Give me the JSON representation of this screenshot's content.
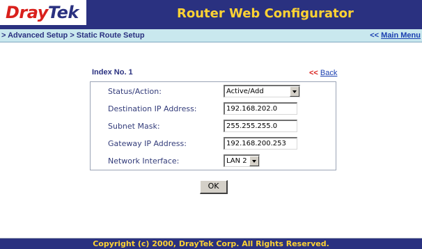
{
  "header": {
    "logo_part1": "Dray",
    "logo_part2": "Tek",
    "app_title": "Router Web Configurator"
  },
  "nav": {
    "breadcrumb": "> Advanced Setup > Static Route Setup",
    "main_menu_arrows": "<<",
    "main_menu_label": "Main Menu"
  },
  "page": {
    "index_label": "Index No. 1",
    "back_arrows": "<<",
    "back_label": "Back"
  },
  "form": {
    "status_label": "Status/Action:",
    "status_value": "Active/Add",
    "dest_label": "Destination IP Address:",
    "dest_value": "192.168.202.0",
    "mask_label": "Subnet Mask:",
    "mask_value": "255.255.255.0",
    "gateway_label": "Gateway IP Address:",
    "gateway_value": "192.168.200.253",
    "iface_label": "Network Interface:",
    "iface_value": "LAN 2",
    "ok_label": "OK"
  },
  "footer": {
    "copyright": "Copyright (c) 2000, DrayTek Corp. All Rights Reserved."
  },
  "colors": {
    "header_bg": "#2a3180",
    "title_yellow": "#ffd333",
    "nav_bg": "#c9e8ee",
    "logo_red": "#d9201c"
  }
}
